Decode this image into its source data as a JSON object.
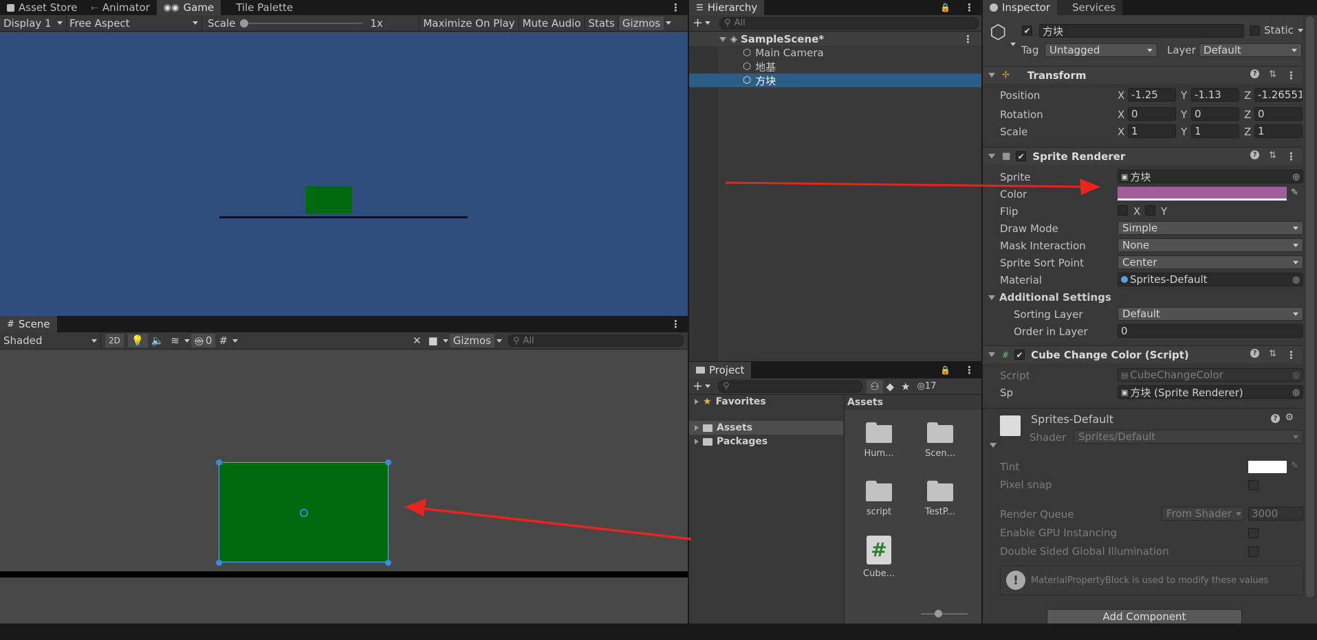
{
  "game_tabs": [
    {
      "label": "Asset Store",
      "icon": "bag-icon"
    },
    {
      "label": "Animator",
      "icon": "animator-icon"
    },
    {
      "label": "Game",
      "icon": "gamepad-icon"
    },
    {
      "label": "Tile Palette",
      "icon": ""
    }
  ],
  "game_toolbar": {
    "display": "Display 1",
    "aspect": "Free Aspect",
    "scale_label": "Scale",
    "scale_value": "1x",
    "maximize": "Maximize On Play",
    "mute": "Mute Audio",
    "stats": "Stats",
    "gizmos": "Gizmos"
  },
  "game_view": {
    "background": "#2f4e7d",
    "cube_color": "#006b0e"
  },
  "scene_tab": "Scene",
  "scene_toolbar": {
    "shading": "Shaded",
    "mode_2d": "2D",
    "hidden_count": "0",
    "gizmos": "Gizmos",
    "search_placeholder": "All"
  },
  "hierarchy": {
    "tab": "Hierarchy",
    "search_placeholder": "All",
    "scene": "SampleScene*",
    "items": [
      {
        "label": "Main Camera"
      },
      {
        "label": "地基"
      },
      {
        "label": "方块"
      }
    ],
    "selected_index": 2
  },
  "project": {
    "tab": "Project",
    "hidden_count": "17",
    "tree": [
      {
        "label": "Favorites",
        "icon": "star-icon"
      },
      {
        "label": "Assets",
        "icon": "folder-icon"
      },
      {
        "label": "Packages",
        "icon": "folder-icon"
      }
    ],
    "assets_header": "Assets",
    "assets": [
      {
        "label": "Hum...",
        "type": "folder"
      },
      {
        "label": "Scen...",
        "type": "folder"
      },
      {
        "label": "script",
        "type": "folder"
      },
      {
        "label": "TestP...",
        "type": "folder"
      },
      {
        "label": "Cube...",
        "type": "script"
      }
    ]
  },
  "inspector": {
    "tabs": [
      "Inspector",
      "Services"
    ],
    "object_name": "方块",
    "static_label": "Static",
    "tag_label": "Tag",
    "tag_value": "Untagged",
    "layer_label": "Layer",
    "layer_value": "Default",
    "transform": {
      "title": "Transform",
      "rows": [
        {
          "label": "Position",
          "x": "-1.25",
          "y": "-1.13",
          "z": "-1.26551"
        },
        {
          "label": "Rotation",
          "x": "0",
          "y": "0",
          "z": "0"
        },
        {
          "label": "Scale",
          "x": "1",
          "y": "1",
          "z": "1"
        }
      ]
    },
    "sprite_renderer": {
      "title": "Sprite Renderer",
      "sprite_label": "Sprite",
      "sprite_value": "方块",
      "color_label": "Color",
      "color_value": "#a05e9d",
      "flip_label": "Flip",
      "flip_x": "X",
      "flip_y": "Y",
      "draw_mode_label": "Draw Mode",
      "draw_mode_value": "Simple",
      "mask_label": "Mask Interaction",
      "mask_value": "None",
      "sort_point_label": "Sprite Sort Point",
      "sort_point_value": "Center",
      "material_label": "Material",
      "material_value": "Sprites-Default",
      "additional_label": "Additional Settings",
      "sorting_layer_label": "Sorting Layer",
      "sorting_layer_value": "Default",
      "order_label": "Order in Layer",
      "order_value": "0"
    },
    "script_comp": {
      "title": "Cube Change Color (Script)",
      "script_label": "Script",
      "script_value": "CubeChangeColor",
      "sp_label": "Sp",
      "sp_value": "方块 (Sprite Renderer)"
    },
    "material": {
      "name": "Sprites-Default",
      "shader_label": "Shader",
      "shader_value": "Sprites/Default",
      "tint_label": "Tint",
      "pixel_snap_label": "Pixel snap",
      "render_queue_label": "Render Queue",
      "render_queue_mode": "From Shader",
      "render_queue_value": "3000",
      "gpu_label": "Enable GPU Instancing",
      "double_sided_label": "Double Sided Global Illumination",
      "info": "MaterialPropertyBlock is used to modify these values"
    },
    "add_component": "Add Component"
  },
  "colors": {
    "arrow": "#e8241c",
    "scene_cube": "#006b0e",
    "selection": "#2c5d87"
  }
}
